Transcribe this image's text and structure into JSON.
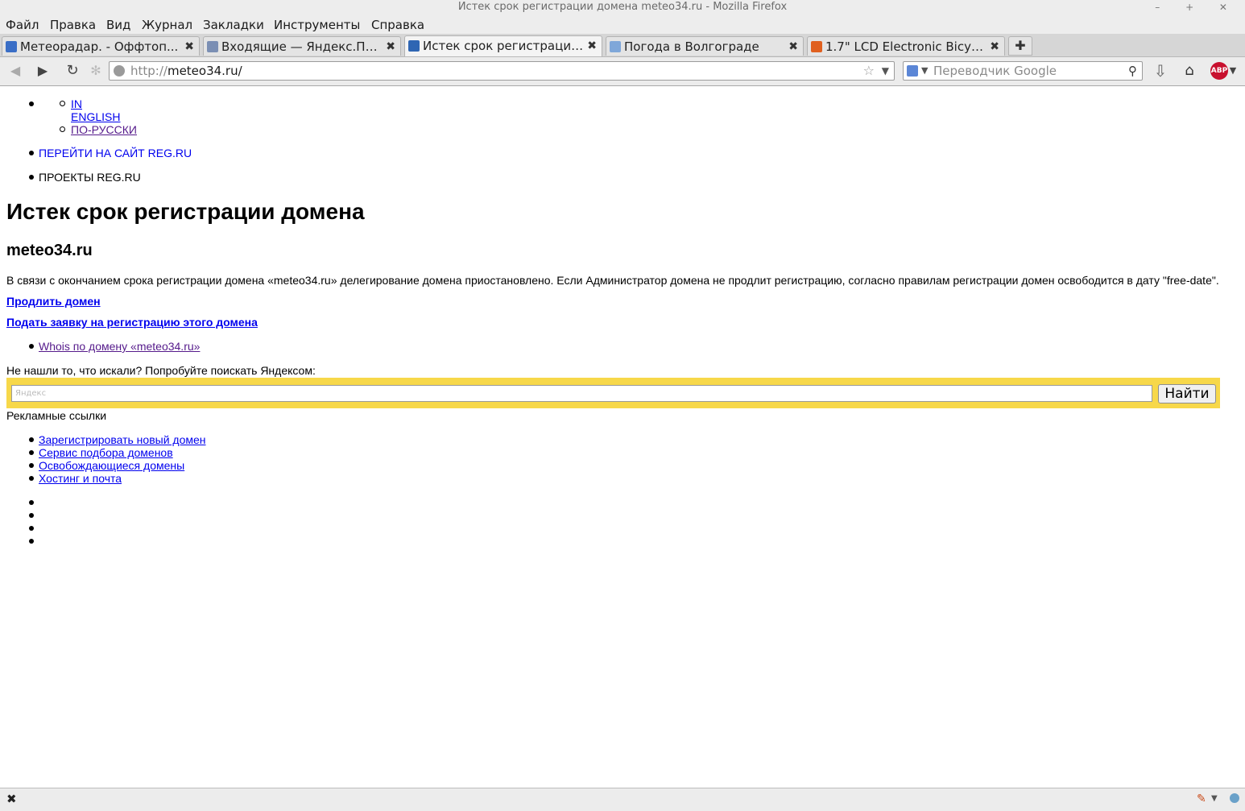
{
  "window": {
    "title": "Истек срок регистрации домена meteo34.ru - Mozilla Firefox",
    "controls": "– + ✕"
  },
  "menu": [
    "Файл",
    "Правка",
    "Вид",
    "Журнал",
    "Закладки",
    "Инструменты",
    "Справка"
  ],
  "tabs": [
    {
      "label": "Метеорадар. - Оффтоп...",
      "favicon_color": "#3a6ec6",
      "active": false
    },
    {
      "label": "Входящие — Яндекс.По...",
      "favicon_color": "#7b8fb4",
      "active": false
    },
    {
      "label": "Истек срок регистрации...",
      "favicon_color": "#2f66b3",
      "active": true
    },
    {
      "label": "Погода в Волгограде",
      "favicon_color": "#7fa7d9",
      "active": false
    },
    {
      "label": "1.7\" LCD Electronic Bicyc...",
      "favicon_color": "#e0601f",
      "active": false
    }
  ],
  "navbar": {
    "url_protocol": "http://",
    "url_host": "meteo34.ru/",
    "search_placeholder": "Переводчик Google",
    "abp_label": "ABP"
  },
  "page": {
    "lang_in": "IN",
    "lang_english": "ENGLISH",
    "lang_ru": "ПО-РУССКИ",
    "goto_regru": "ПЕРЕЙТИ НА САЙТ REG.RU",
    "projects_regru": "ПРОЕКТЫ REG.RU",
    "heading": "Истек срок регистрации домена",
    "domain": "meteo34.ru",
    "notice": "В связи с окончанием срока регистрации домена «meteo34.ru» делегирование домена приостановлено. Если Администратор домена не продлит регистрацию, согласно правилам регистрации домен освободится в дату \"free-date\".",
    "renew_link": "Продлить домен",
    "apply_link": "Подать заявку на регистрацию этого домена",
    "whois_link": "Whois по домену «meteo34.ru»",
    "search_prompt": "Не нашли то, что искали? Попробуйте поискать Яндексом:",
    "yandex_placeholder": "Яндекс",
    "search_button": "Найти",
    "ads_title": "Рекламные ссылки",
    "ads": [
      "Зарегистрировать новый домен",
      "Сервис подбора доменов",
      "Освобождающиеся домены",
      "Хостинг и почта"
    ]
  },
  "colors": {
    "link": "#0000ee",
    "visited": "#551a8b",
    "yandex_bar": "#f7d84a"
  }
}
